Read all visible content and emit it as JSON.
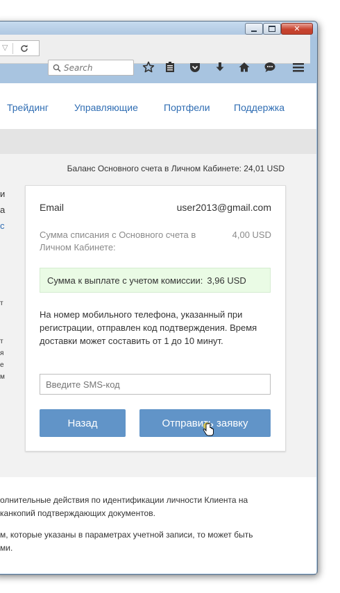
{
  "window": {
    "buttons": {
      "minimize": "",
      "maximize": "",
      "close": "✕"
    }
  },
  "toolbar": {
    "search_placeholder": "Search",
    "dropdown_glyph": "▽",
    "reload_glyph": "C"
  },
  "nav": {
    "items": [
      "Трейдинг",
      "Управляющие",
      "Портфели",
      "Поддержка"
    ]
  },
  "balance_text": "Баланс Основного счета в Личном Кабинете: 24,01 USD",
  "left_fragments": [
    "и",
    "а",
    "с",
    "т",
    "т",
    "я",
    "е",
    "м"
  ],
  "card": {
    "email_label": "Email",
    "email_value": "user2013@gmail.com",
    "charge_label": "Сумма списания с Основного счета в Личном Кабинете:",
    "charge_value": "4,00 USD",
    "payout_label": "Сумма к выплате с учетом комиссии:",
    "payout_value": "3,96 USD",
    "info_text": "На номер мобильного телефона, указанный при регистрации, отправлен код подтверждения. Время доставки может составить от 1 до 10 минут.",
    "sms_placeholder": "Введите SMS-код",
    "back_label": "Назад",
    "submit_label": "Отправить заявку"
  },
  "footer": {
    "line1": "олнительные действия по идентификации личности Клиента на",
    "line2": "канкопий подтверждающих документов.",
    "line3": "м, которые указаны в параметрах учетной записи, то может быть",
    "line4": "ми."
  },
  "colors": {
    "accent": "#2f6db3",
    "button": "#6194c8",
    "payout_bg": "#eafbe5"
  }
}
